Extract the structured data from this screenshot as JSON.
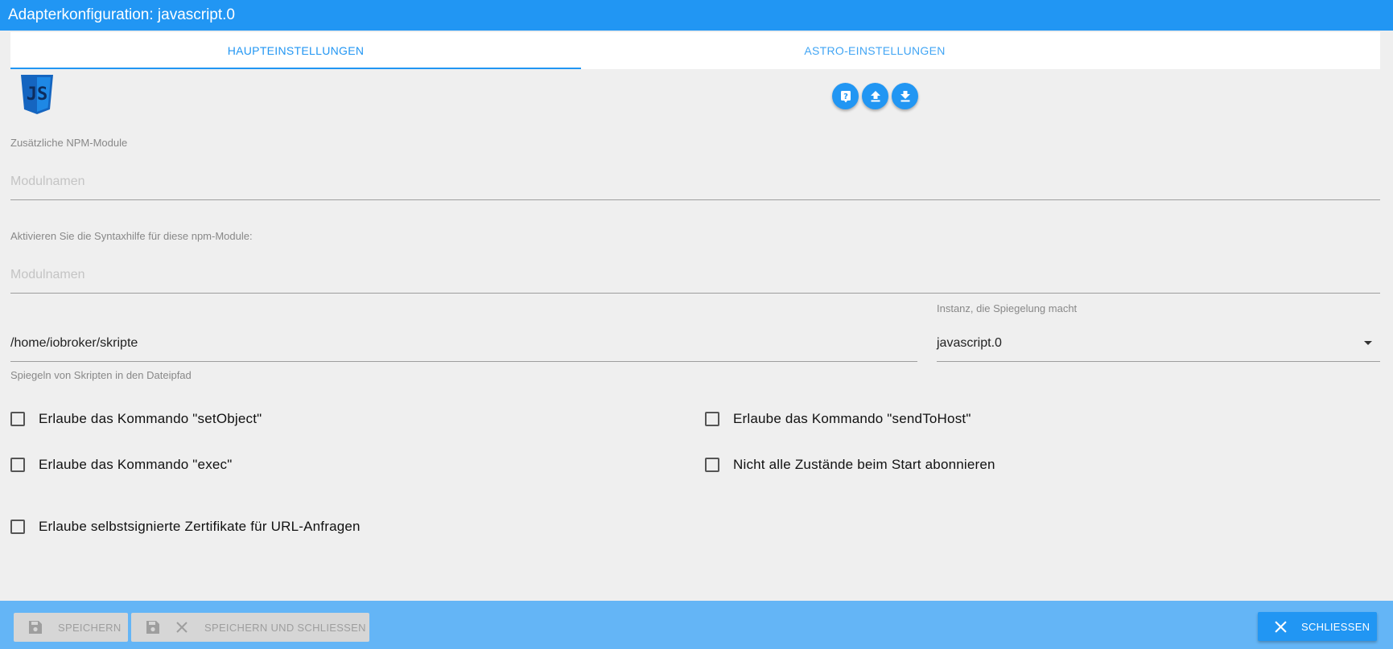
{
  "window": {
    "title": "Adapterkonfiguration: javascript.0"
  },
  "tabs": [
    {
      "label": "HAUPTEINSTELLUNGEN",
      "active": true
    },
    {
      "label": "ASTRO-EINSTELLUNGEN",
      "active": false
    }
  ],
  "logo": {
    "icon": "javascript-logo",
    "color": "#1565c0"
  },
  "toolbar_icons": [
    "help-icon",
    "upload-icon",
    "download-icon"
  ],
  "npm": {
    "label": "Zusätzliche NPM-Module",
    "placeholder": "Modulnamen"
  },
  "syntax": {
    "label": "Aktivieren Sie die Syntaxhilfe für diese npm-Module:",
    "placeholder": "Modulnamen"
  },
  "mirror": {
    "path_value": "/home/iobroker/skripte",
    "path_helper": "Spiegeln von Skripten in den Dateipfad",
    "instance_label": "Instanz, die Spiegelung macht",
    "instance_value": "javascript.0"
  },
  "checkboxes": {
    "set_object": {
      "label": "Erlaube das Kommando \"setObject\"",
      "checked": false
    },
    "send_to_host": {
      "label": "Erlaube das Kommando \"sendToHost\"",
      "checked": false
    },
    "exec": {
      "label": "Erlaube das Kommando \"exec\"",
      "checked": false
    },
    "no_subscribe": {
      "label": "Nicht alle Zustände beim Start abonnieren",
      "checked": false
    },
    "self_signed": {
      "label": "Erlaube selbstsignierte Zertifikate für URL-Anfragen",
      "checked": false
    }
  },
  "footer": {
    "save_label": "SPEICHERN",
    "save_close_label": "SPEICHERN UND SCHLIESSEN",
    "close_label": "SCHLIESSEN"
  },
  "colors": {
    "accent": "#2196f3",
    "footer": "#64b5f6",
    "background": "#efefef"
  }
}
